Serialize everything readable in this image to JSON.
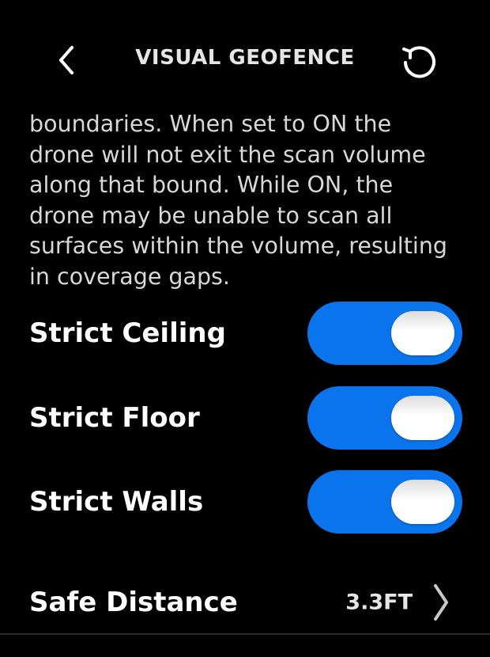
{
  "header": {
    "title": "VISUAL GEOFENCE",
    "back_icon": "chevron-left-icon",
    "refresh_icon": "refresh-icon"
  },
  "description": {
    "lines": [
      "boundaries. When set to ON the",
      "drone will not exit the scan volume",
      "along that bound. While ON, the",
      "drone may be unable to scan all",
      "surfaces within the volume, resulting",
      "in coverage gaps."
    ]
  },
  "settings": [
    {
      "label": "Strict Ceiling",
      "on": true
    },
    {
      "label": "Strict Floor",
      "on": true
    },
    {
      "label": "Strict Walls",
      "on": true
    }
  ],
  "safe_distance": {
    "label": "Safe Distance",
    "value": "3.3FT",
    "icon": "chevron-right-icon"
  },
  "colors": {
    "background": "#000000",
    "accent": "#0a74ec",
    "text": "#ffffff"
  }
}
